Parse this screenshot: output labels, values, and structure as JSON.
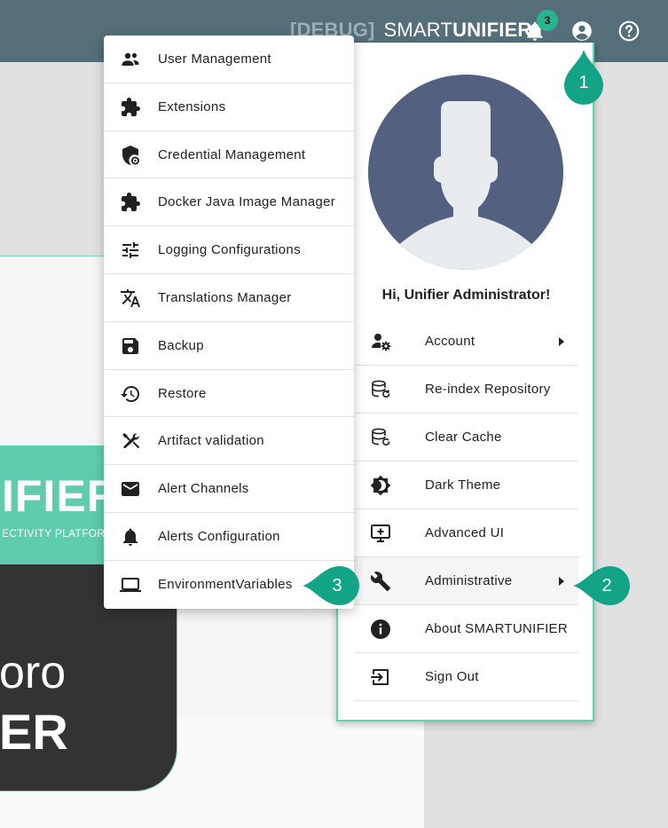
{
  "header": {
    "debug_tag": "[DEBUG]",
    "brand_light": "SMART",
    "brand_bold": "UNIFIER",
    "notification_count": "3",
    "icons": [
      "bell-icon",
      "account-circle-icon",
      "help-circle-icon"
    ]
  },
  "background": {
    "logo_banner_text": "IFIER",
    "logo_banner_subtext": "ECTIVITY PLATFOR",
    "logo_dark_line1": "oro",
    "logo_dark_line2": "ER"
  },
  "user_panel": {
    "greeting": "Hi, Unifier Administrator!",
    "items": [
      {
        "label": "Account",
        "icon": "user-cog-icon",
        "has_submenu": true
      },
      {
        "label": "Re-index Repository",
        "icon": "database-refresh-icon",
        "has_submenu": false
      },
      {
        "label": "Clear Cache",
        "icon": "database-clear-icon",
        "has_submenu": false
      },
      {
        "label": "Dark Theme",
        "icon": "brightness-icon",
        "has_submenu": false
      },
      {
        "label": "Advanced UI",
        "icon": "monitor-plus-icon",
        "has_submenu": false
      },
      {
        "label": "Administrative",
        "icon": "wrench-icon",
        "has_submenu": true
      },
      {
        "label": "About SMARTUNIFIER",
        "icon": "info-icon",
        "has_submenu": false
      },
      {
        "label": "Sign Out",
        "icon": "sign-out-icon",
        "has_submenu": false
      }
    ]
  },
  "admin_menu": {
    "items": [
      {
        "label": "User Management",
        "icon": "users-icon"
      },
      {
        "label": "Extensions",
        "icon": "puzzle-icon"
      },
      {
        "label": "Credential Management",
        "icon": "shield-key-icon"
      },
      {
        "label": "Docker Java Image Manager",
        "icon": "puzzle-icon"
      },
      {
        "label": "Logging Configurations",
        "icon": "tune-icon"
      },
      {
        "label": "Translations Manager",
        "icon": "translate-icon"
      },
      {
        "label": "Backup",
        "icon": "floppy-disk-icon"
      },
      {
        "label": "Restore",
        "icon": "history-icon"
      },
      {
        "label": "Artifact validation",
        "icon": "tools-icon"
      },
      {
        "label": "Alert Channels",
        "icon": "envelope-icon"
      },
      {
        "label": "Alerts Configuration",
        "icon": "bell-icon"
      },
      {
        "label": "EnvironmentVariables",
        "icon": "laptop-icon"
      }
    ]
  },
  "callouts": [
    "1",
    "2",
    "3"
  ],
  "colors": {
    "header_bg": "#546e7a",
    "accent": "#26b58e",
    "avatar_bg": "#546080",
    "panel_border": "#5fd3b3"
  }
}
